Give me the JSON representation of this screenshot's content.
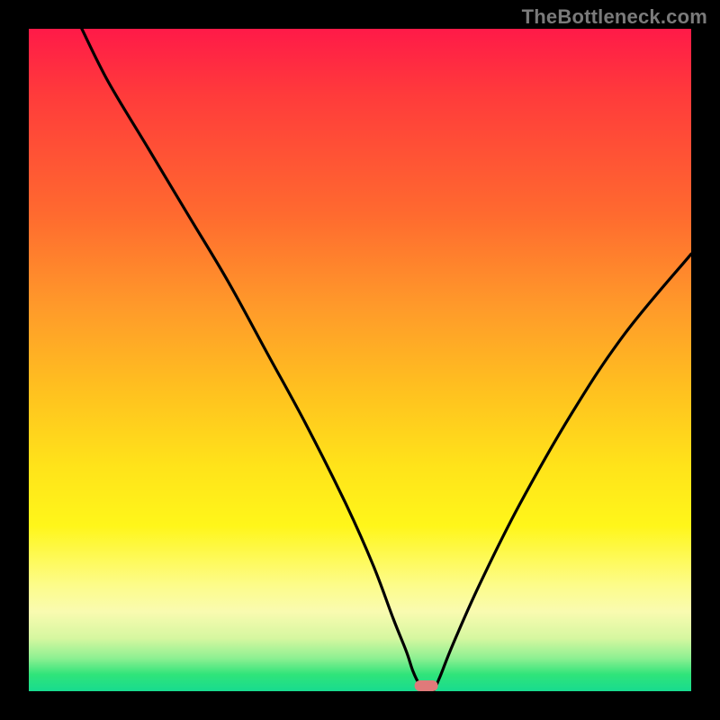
{
  "watermark": "TheBottleneck.com",
  "chart_data": {
    "type": "line",
    "title": "",
    "xlabel": "",
    "ylabel": "",
    "xlim": [
      0,
      100
    ],
    "ylim": [
      0,
      100
    ],
    "grid": false,
    "legend": false,
    "series": [
      {
        "name": "bottleneck-curve",
        "x": [
          8,
          12,
          18,
          24,
          30,
          36,
          42,
          48,
          52,
          55,
          57,
          58,
          59,
          60,
          61,
          62,
          64,
          68,
          74,
          82,
          90,
          100
        ],
        "y": [
          100,
          92,
          82,
          72,
          62,
          51,
          40,
          28,
          19,
          11,
          6,
          3,
          1,
          0,
          0,
          2,
          7,
          16,
          28,
          42,
          54,
          66
        ]
      }
    ],
    "marker": {
      "x": 60,
      "y": 0,
      "shape": "rounded-rect",
      "color": "#e07a7a"
    },
    "background_gradient": {
      "orientation": "vertical",
      "stops": [
        {
          "pos": 0.0,
          "color": "#ff1a48"
        },
        {
          "pos": 0.28,
          "color": "#ff6a2f"
        },
        {
          "pos": 0.55,
          "color": "#ffc21f"
        },
        {
          "pos": 0.75,
          "color": "#fff61a"
        },
        {
          "pos": 0.92,
          "color": "#d6f7a0"
        },
        {
          "pos": 1.0,
          "color": "#18db8f"
        }
      ]
    }
  }
}
